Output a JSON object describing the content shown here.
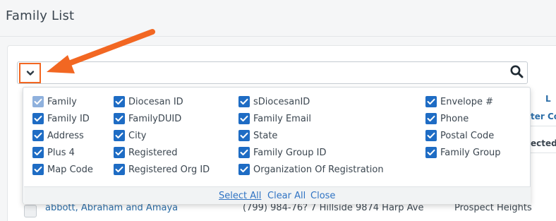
{
  "page": {
    "title": "Family List"
  },
  "search": {
    "toggle_icon": "chevron-down-icon",
    "search_icon": "magnifier-icon"
  },
  "columns_menu": {
    "options": [
      {
        "label": "Family",
        "checked": true,
        "disabled": true
      },
      {
        "label": "Family ID",
        "checked": true
      },
      {
        "label": "Address",
        "checked": true
      },
      {
        "label": "Plus 4",
        "checked": true
      },
      {
        "label": "Map Code",
        "checked": true
      },
      {
        "label": "Diocesan ID",
        "checked": true
      },
      {
        "label": "FamilyDUID",
        "checked": true
      },
      {
        "label": "City",
        "checked": true
      },
      {
        "label": "Registered",
        "checked": true
      },
      {
        "label": "Registered Org ID",
        "checked": true
      },
      {
        "label": "sDiocesanID",
        "checked": true
      },
      {
        "label": "Family Email",
        "checked": true
      },
      {
        "label": "State",
        "checked": true
      },
      {
        "label": "Family Group ID",
        "checked": true
      },
      {
        "label": "Organization Of Registration",
        "checked": true
      },
      {
        "label": "Envelope #",
        "checked": true
      },
      {
        "label": "Phone",
        "checked": true
      },
      {
        "label": "Postal Code",
        "checked": true
      },
      {
        "label": "Family Group",
        "checked": true
      }
    ],
    "footer": {
      "select_all": "Select All",
      "clear_all": "Clear All",
      "close": "Close"
    }
  },
  "background_table": {
    "header_partial": "L",
    "filter_partial_1": "ter Co",
    "filter_partial_2": "ected F",
    "row": {
      "name": "abbott, Abraham and Amaya",
      "phone_address": "(799) 984-76? 7 Hillside 9874 Harp Ave",
      "city": "Prospect Heights"
    }
  },
  "colors": {
    "accent_orange": "#f26722",
    "checkbox_blue": "#1e6cc4",
    "link_blue": "#2f73c3"
  }
}
